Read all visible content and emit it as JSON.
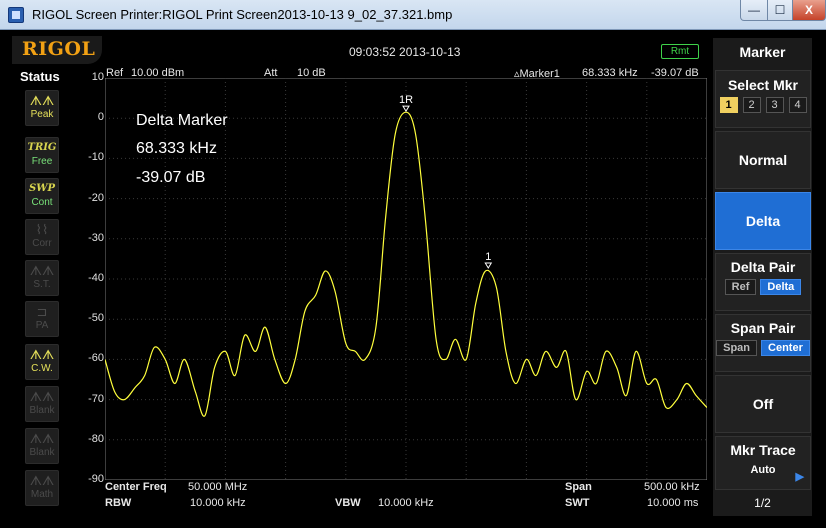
{
  "window": {
    "title": "RIGOL Screen Printer:RIGOL Print Screen2013-10-13 9_02_37.321.bmp",
    "min_label": "—",
    "max_label": "☐",
    "close_label": "X"
  },
  "header": {
    "brand": "RIGOL",
    "timestamp": "09:03:52 2013-10-13",
    "remote_badge": "Rmt"
  },
  "status": {
    "title": "Status",
    "buttons": [
      {
        "icon": "ᗑᗑ",
        "label": "Peak",
        "state": "on"
      },
      {
        "icon": "TRIG",
        "label": "Free",
        "state": "green"
      },
      {
        "icon": "SWP",
        "label": "Cont",
        "state": "green"
      },
      {
        "icon": "⌇⌇",
        "label": "Corr",
        "state": "off"
      },
      {
        "icon": "ᗑᗑ",
        "label": "S.T.",
        "state": "off"
      },
      {
        "icon": "⊐",
        "label": "PA",
        "state": "off"
      },
      {
        "icon": "ᗑᗑ",
        "label": "C.W.",
        "state": "on"
      },
      {
        "icon": "ᗑᗑ",
        "label": "Blank",
        "state": "off"
      },
      {
        "icon": "ᗑᗑ",
        "label": "Blank",
        "state": "off"
      },
      {
        "icon": "ᗑᗑ",
        "label": "Math",
        "state": "off"
      }
    ]
  },
  "info": {
    "ref_label": "Ref",
    "ref_value": "10.00 dBm",
    "att_label": "Att",
    "att_value": "10 dB",
    "marker_label": "▵Marker1",
    "marker_freq": "68.333 kHz",
    "marker_level": "-39.07 dB"
  },
  "delta_readout": {
    "title": "Delta Marker",
    "freq": "68.333 kHz",
    "level": "-39.07 dB"
  },
  "bottom": {
    "center_label": "Center Freq",
    "center_value": "50.000 MHz",
    "rbw_label": "RBW",
    "rbw_value": "10.000 kHz",
    "vbw_label": "VBW",
    "vbw_value": "10.000 kHz",
    "span_label": "Span",
    "span_value": "500.00 kHz",
    "swt_label": "SWT",
    "swt_value": "10.000 ms"
  },
  "panel": {
    "title": "Marker",
    "select_mkr_label": "Select Mkr",
    "marker_numbers": [
      "1",
      "2",
      "3",
      "4"
    ],
    "selected_marker": "1",
    "normal_label": "Normal",
    "delta_label": "Delta",
    "delta_pair_label": "Delta Pair",
    "delta_pair_options": [
      "Ref",
      "Delta"
    ],
    "delta_pair_selected": "Delta",
    "span_pair_label": "Span Pair",
    "span_pair_options": [
      "Span",
      "Center"
    ],
    "span_pair_selected": "Center",
    "off_label": "Off",
    "mkr_trace_label": "Mkr Trace",
    "mkr_trace_value": "Auto",
    "page": "1/2"
  },
  "colors": {
    "trace": "#ffff3c",
    "grid": "#3a3a3a",
    "accent": "#1f6ed4",
    "brand": "#f2a114"
  },
  "chart_data": {
    "type": "line",
    "y_ticks": [
      "10",
      "0",
      "-10",
      "-20",
      "-30",
      "-40",
      "-50",
      "-60",
      "-70",
      "-80",
      "-90"
    ],
    "ylim": [
      -90,
      10
    ],
    "xlim": [
      49.75,
      50.25
    ],
    "x_unit": "MHz",
    "grid": true,
    "markers": [
      {
        "label": "1R",
        "x": 50.0,
        "y": 1.5
      },
      {
        "label": "1",
        "x": 50.068333,
        "y": -37.5
      }
    ],
    "x": [
      49.75,
      49.758,
      49.766,
      49.775,
      49.783,
      49.791,
      49.8,
      49.808,
      49.816,
      49.825,
      49.833,
      49.841,
      49.85,
      49.858,
      49.866,
      49.875,
      49.883,
      49.891,
      49.9,
      49.908,
      49.916,
      49.925,
      49.933,
      49.941,
      49.95,
      49.958,
      49.966,
      49.975,
      49.983,
      49.991,
      50.0,
      50.008,
      50.016,
      50.025,
      50.033,
      50.041,
      50.05,
      50.058,
      50.066,
      50.075,
      50.083,
      50.091,
      50.1,
      50.108,
      50.116,
      50.125,
      50.133,
      50.141,
      50.15,
      50.158,
      50.166,
      50.175,
      50.183,
      50.191,
      50.2,
      50.208,
      50.216,
      50.225,
      50.233,
      50.241,
      50.25
    ],
    "values": [
      -60,
      -68,
      -70,
      -67,
      -64,
      -57,
      -60,
      -66,
      -60,
      -68,
      -74,
      -62,
      -58,
      -64,
      -54,
      -58,
      -52,
      -60,
      -66,
      -60,
      -48,
      -44,
      -38,
      -43,
      -56,
      -58,
      -60,
      -52,
      -25,
      -4,
      1.5,
      -4,
      -25,
      -55,
      -60,
      -55,
      -60,
      -46,
      -38,
      -42,
      -58,
      -66,
      -60,
      -64,
      -58,
      -62,
      -58,
      -70,
      -63,
      -66,
      -58,
      -62,
      -69,
      -58,
      -66,
      -65,
      -72,
      -70,
      -66,
      -69,
      -72
    ]
  }
}
